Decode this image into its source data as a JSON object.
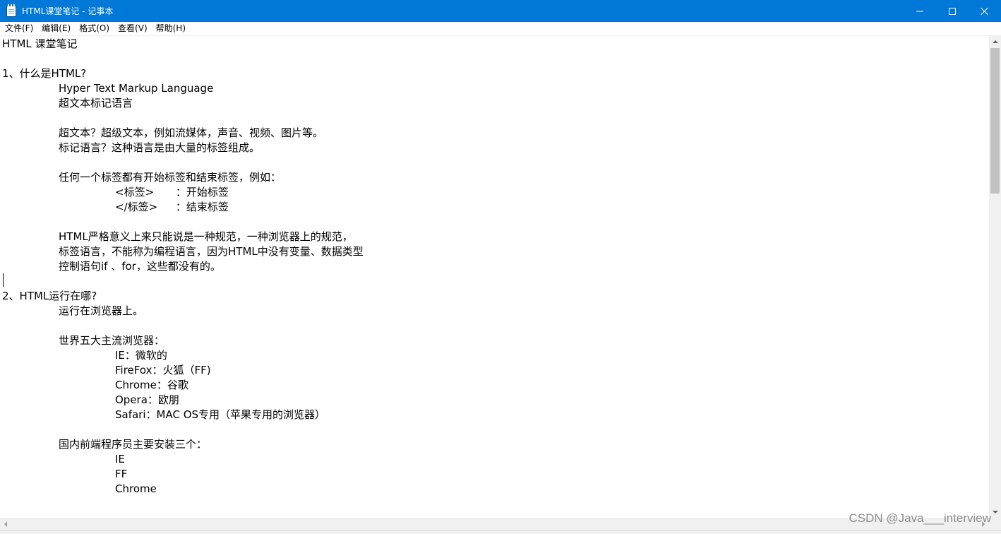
{
  "window": {
    "title": "HTML课堂笔记 - 记事本",
    "icon": "notepad-icon",
    "controls": [
      "minimize-icon",
      "maximize-icon",
      "close-icon"
    ]
  },
  "menu": {
    "items": [
      "文件(F)",
      "编辑(E)",
      "格式(O)",
      "查看(V)",
      "帮助(H)"
    ]
  },
  "editor": {
    "lines": [
      "HTML 课堂笔记",
      "",
      "1、什么是HTML?",
      "\t\tHyper Text Markup Language",
      "\t\t超文本标记语言",
      "",
      "\t\t超文本？超级文本，例如流媒体，声音、视频、图片等。",
      "\t\t标记语言？这种语言是由大量的标签组成。",
      "",
      "\t\t任何一个标签都有开始标签和结束标签，例如：",
      "\t\t\t\t<标签>\t：开始标签",
      "\t\t\t\t</标签>\t：结束标签",
      "",
      "\t\tHTML严格意义上来只能说是一种规范，一种浏览器上的规范，",
      "\t\t标签语言，不能称为编程语言，因为HTML中没有变量、数据类型",
      "\t\t控制语句if 、for，这些都没有的。",
      "",
      "2、HTML运行在哪?",
      "\t\t运行在浏览器上。",
      "",
      "\t\t世界五大主流浏览器：",
      "\t\t\t\tIE：微软的",
      "\t\t\t\tFireFox：火狐（FF)",
      "\t\t\t\tChrome：谷歌",
      "\t\t\t\tOpera：欧朋",
      "\t\t\t\tSafari：MAC OS专用（苹果专用的浏览器）",
      "",
      "\t\t国内前端程序员主要安装三个：",
      "\t\t\t\tIE",
      "\t\t\t\tFF",
      "\t\t\t\tChrome"
    ]
  },
  "watermark": "CSDN @Java___interview"
}
